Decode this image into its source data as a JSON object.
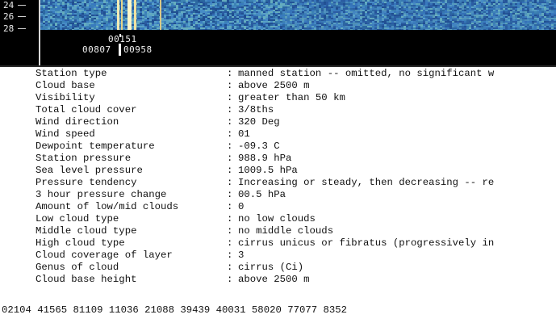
{
  "waterfall": {
    "axis_labels": [
      "24",
      "26",
      "28"
    ],
    "timestamps": {
      "upper": "00151",
      "left": "00807",
      "right": "00958"
    }
  },
  "report": {
    "rows": [
      {
        "key": "Station type",
        "value": "manned station -- omitted, no significant w"
      },
      {
        "key": "Cloud base",
        "value": "above 2500 m"
      },
      {
        "key": "Visibility",
        "value": "greater than 50 km"
      },
      {
        "key": "Total cloud cover",
        "value": "3/8ths"
      },
      {
        "key": "Wind direction",
        "value": "320 Deg"
      },
      {
        "key": "Wind speed",
        "value": "01"
      },
      {
        "key": "Dewpoint temperature",
        "value": "-09.3 C"
      },
      {
        "key": "Station pressure",
        "value": "988.9 hPa"
      },
      {
        "key": "Sea level pressure",
        "value": "1009.5 hPa"
      },
      {
        "key": "Pressure tendency",
        "value": "Increasing or steady, then decreasing -- re"
      },
      {
        "key": "3 hour pressure change",
        "value": "00.5 hPa"
      },
      {
        "key": "Amount of low/mid clouds",
        "value": "0"
      },
      {
        "key": "Low cloud type",
        "value": "no low clouds"
      },
      {
        "key": "Middle cloud type",
        "value": "no middle clouds"
      },
      {
        "key": "High cloud type",
        "value": "cirrus unicus or fibratus (progressively in"
      },
      {
        "key": "Cloud coverage of layer",
        "value": "3"
      },
      {
        "key": "Genus of cloud",
        "value": "cirrus (Ci)"
      },
      {
        "key": "Cloud base height",
        "value": "above 2500 m"
      }
    ],
    "separator": ":",
    "raw_synop": "02104 41565 81109 11036 21088 39439 40031 58020 77077 8352"
  },
  "colors": {
    "waterfall_background": "#000000",
    "waterfall_noise": "#2f6fb0",
    "waterfall_signal": "#f2e8a8",
    "text": "#111111"
  }
}
